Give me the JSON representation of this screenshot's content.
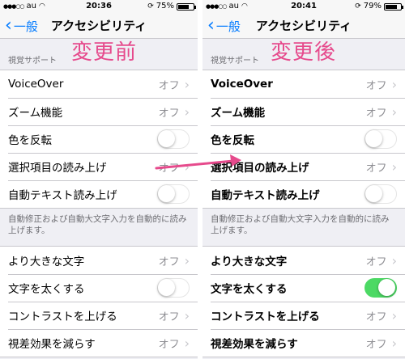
{
  "colors": {
    "annotation": "#e64a8c",
    "ios_blue": "#007aff",
    "switch_on": "#4cd964"
  },
  "screens": [
    {
      "label": "変更前",
      "status": {
        "carrier": "au",
        "time": "20:36",
        "battery": "75%",
        "battery_level": 0.75
      },
      "nav": {
        "back": "一般",
        "title": "アクセシビリティ"
      },
      "section_header": "視覚サポート",
      "group1": [
        {
          "label": "VoiceOver",
          "value": "オフ",
          "type": "disclosure"
        },
        {
          "label": "ズーム機能",
          "value": "オフ",
          "type": "disclosure"
        },
        {
          "label": "色を反転",
          "type": "switch",
          "on": false
        },
        {
          "label": "選択項目の読み上げ",
          "value": "オフ",
          "type": "disclosure"
        },
        {
          "label": "自動テキスト読み上げ",
          "type": "switch",
          "on": false
        }
      ],
      "footer": "自動修正および自動大文字入力を自動的に読み上げます。",
      "group2": [
        {
          "label": "より大きな文字",
          "value": "オフ",
          "type": "disclosure"
        },
        {
          "label": "文字を太くする",
          "type": "switch",
          "on": false
        },
        {
          "label": "コントラストを上げる",
          "value": "オフ",
          "type": "disclosure"
        },
        {
          "label": "視差効果を減らす",
          "value": "オフ",
          "type": "disclosure"
        }
      ]
    },
    {
      "label": "変更後",
      "status": {
        "carrier": "au",
        "time": "20:41",
        "battery": "79%",
        "battery_level": 0.79
      },
      "nav": {
        "back": "一般",
        "title": "アクセシビリティ"
      },
      "section_header": "視覚サポート",
      "group1": [
        {
          "label": "VoiceOver",
          "value": "オフ",
          "type": "disclosure"
        },
        {
          "label": "ズーム機能",
          "value": "オフ",
          "type": "disclosure"
        },
        {
          "label": "色を反転",
          "type": "switch",
          "on": false
        },
        {
          "label": "選択項目の読み上げ",
          "value": "オフ",
          "type": "disclosure"
        },
        {
          "label": "自動テキスト読み上げ",
          "type": "switch",
          "on": false
        }
      ],
      "footer": "自動修正および自動大文字入力を自動的に読み上げます。",
      "group2": [
        {
          "label": "より大きな文字",
          "value": "オフ",
          "type": "disclosure"
        },
        {
          "label": "文字を太くする",
          "type": "switch",
          "on": true
        },
        {
          "label": "コントラストを上げる",
          "value": "オフ",
          "type": "disclosure"
        },
        {
          "label": "視差効果を減らす",
          "value": "オフ",
          "type": "disclosure"
        }
      ]
    }
  ]
}
